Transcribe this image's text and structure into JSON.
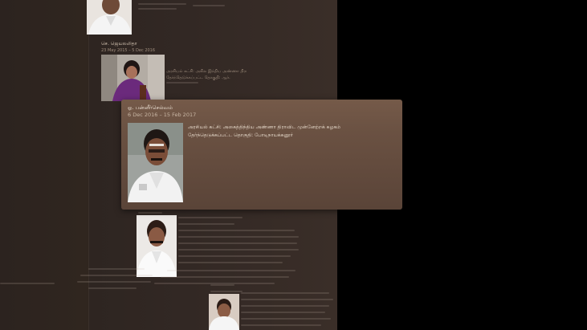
{
  "colors": {
    "background": "#000000",
    "panel": "#322824",
    "card": "#6a5142",
    "card_text": "#f1e6da"
  },
  "timeline": {
    "entries": [
      {
        "name": "செ. ஜெயலலிதா",
        "dates": "23 May 2015 – 5 Dec 2016",
        "description_lines": [
          "அரசியல் கட்சி: அகில இந்திய அண்ணா திராவிட முன்னேற்றக் கழகம்",
          "தேர்ந்தெடுக்கப்பட்ட தொகுதி: ஆர்.கே. நகர்"
        ]
      },
      {
        "name": "எடப்பாடி க. பழனிசாமி",
        "dates": "16 Feb 2017 – 6 May 2021"
      },
      {
        "name": "மு. க. ஸ்டாலின்",
        "dates": "7 May 2021"
      }
    ]
  },
  "highlight_card": {
    "name": "ஓ. பன்னீர்செல்வம்",
    "dates": "6 Dec 2016 – 15 Feb 2017",
    "description_line1": "அரசியல் கட்சி: அகைத்திந்திய அண்ணா திராவிட முன்னேற்றக் கழகம்",
    "description_line2": "தேர்ந்தெடுக்கப்பட்ட தொகுதி: போடிநாயக்கனூர்"
  }
}
